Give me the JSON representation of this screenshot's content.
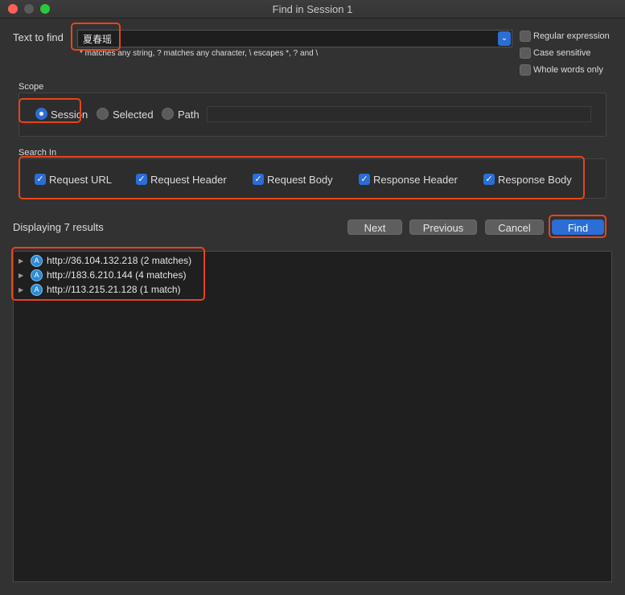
{
  "window": {
    "title": "Find in Session 1"
  },
  "search": {
    "label": "Text to find",
    "value": "夏春瑶",
    "hint": "* matches any string, ? matches any character, \\ escapes *, ? and \\"
  },
  "options": {
    "regular_expression": {
      "label": "Regular expression",
      "checked": false
    },
    "case_sensitive": {
      "label": "Case sensitive",
      "checked": false
    },
    "whole_words_only": {
      "label": "Whole words only",
      "checked": false
    }
  },
  "scope": {
    "label": "Scope",
    "options": [
      {
        "label": "Session",
        "selected": true
      },
      {
        "label": "Selected",
        "selected": false
      },
      {
        "label": "Path",
        "selected": false
      }
    ],
    "path_value": ""
  },
  "search_in": {
    "label": "Search In",
    "items": [
      {
        "label": "Request URL",
        "checked": true
      },
      {
        "label": "Request Header",
        "checked": true
      },
      {
        "label": "Request Body",
        "checked": true
      },
      {
        "label": "Response Header",
        "checked": true
      },
      {
        "label": "Response Body",
        "checked": true
      }
    ]
  },
  "status": {
    "text": "Displaying 7 results"
  },
  "buttons": {
    "next": "Next",
    "previous": "Previous",
    "cancel": "Cancel",
    "find": "Find"
  },
  "results": [
    {
      "label": "http://36.104.132.218 (2 matches)"
    },
    {
      "label": "http://183.6.210.144 (4 matches)"
    },
    {
      "label": "http://113.215.21.128 (1 match)"
    }
  ],
  "colors": {
    "accent": "#2a6ed6",
    "highlight": "#e8441b",
    "background": "#323232"
  }
}
